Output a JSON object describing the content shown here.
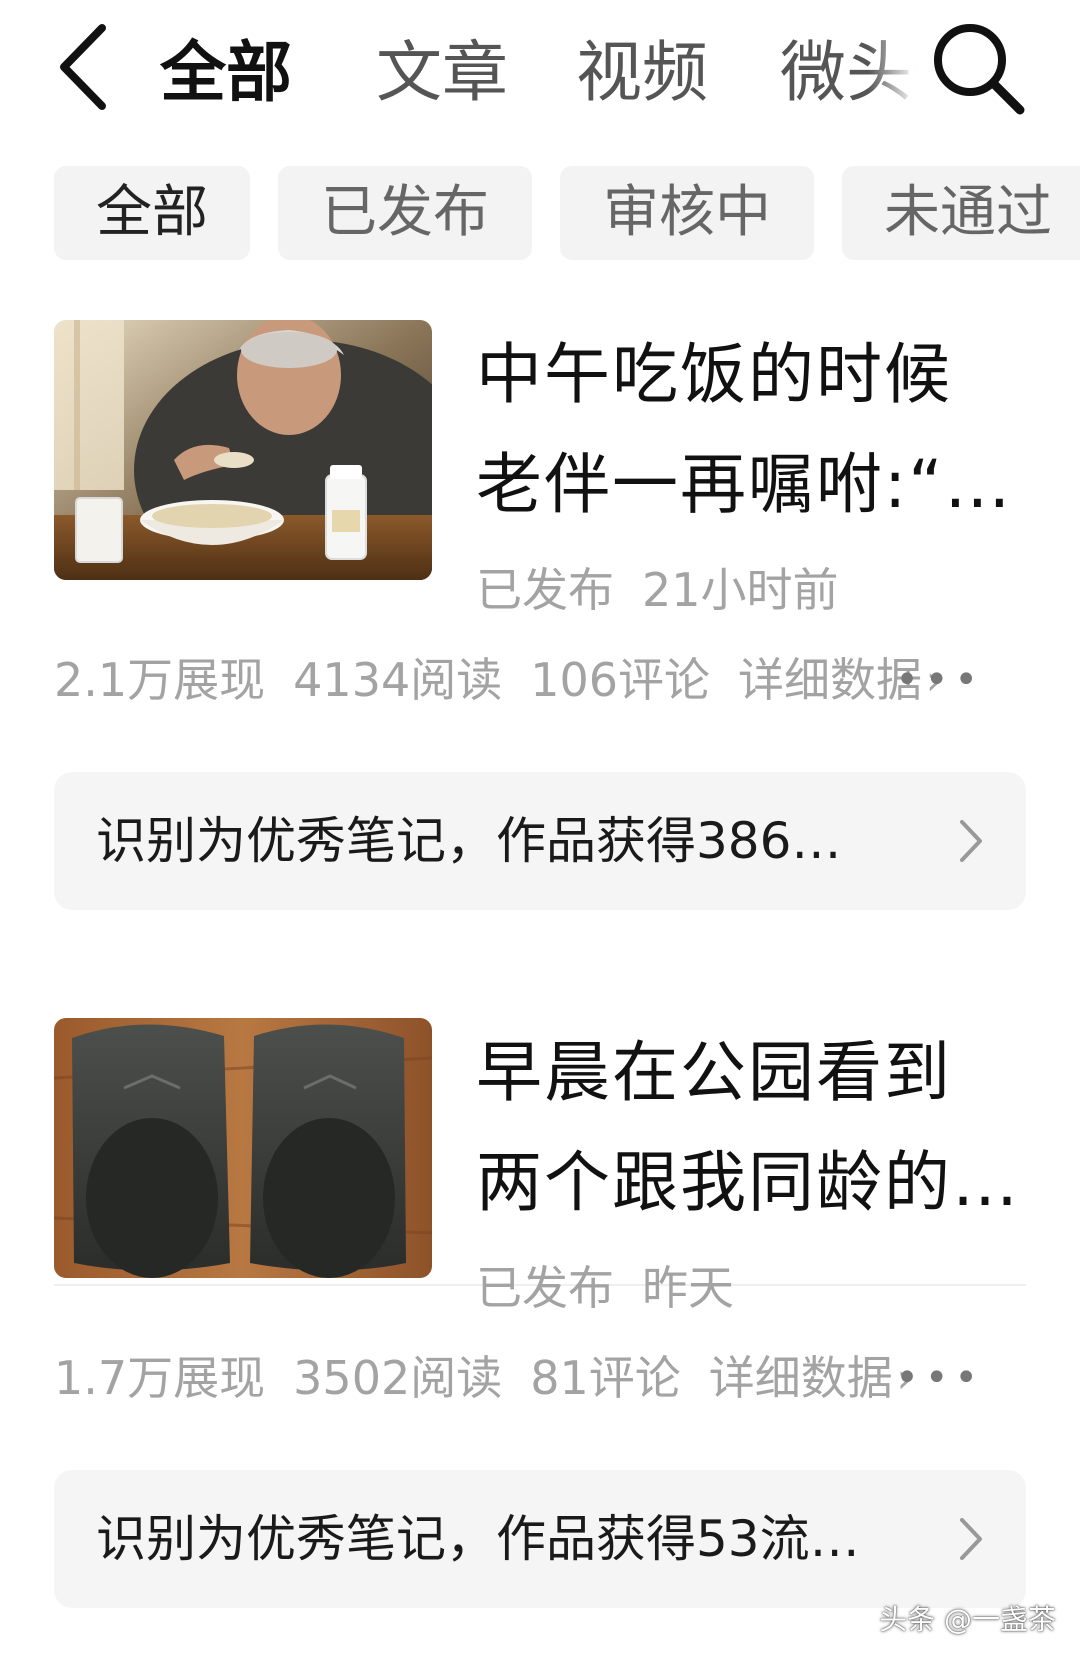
{
  "header": {
    "back_icon": "chevron-left-icon",
    "tabs": [
      "全部",
      "文章",
      "视频",
      "微头条"
    ],
    "active_tab": "全部",
    "search_icon": "search-icon"
  },
  "filters": {
    "chips": [
      "全部",
      "已发布",
      "审核中",
      "未通过"
    ],
    "active_chip": "全部"
  },
  "posts": [
    {
      "title_line1": "中午吃饭的时候",
      "title_line2": "老伴一再嘱咐:“…",
      "status": "已发布",
      "time": "21小时前",
      "impressions": "2.1万展现",
      "reads": "4134阅读",
      "comments": "106评论",
      "detail_link": "详细数据",
      "more_icon": "more-dots-icon",
      "banner_text": "识别为优秀笔记，作品获得386…"
    },
    {
      "title_line1": "早晨在公园看到",
      "title_line2": "两个跟我同龄的…",
      "status": "已发布",
      "time": "昨天",
      "impressions": "1.7万展现",
      "reads": "3502阅读",
      "comments": "81评论",
      "detail_link": "详细数据",
      "more_icon": "more-dots-icon",
      "banner_text": "识别为优秀笔记，作品获得53流…"
    }
  ],
  "watermark": "头条 @一盏茶",
  "colors": {
    "chip_bg": "#f3f3f3",
    "banner_bg": "#f5f5f5",
    "meta_text": "#a3a3a3",
    "title_text": "#111111"
  }
}
